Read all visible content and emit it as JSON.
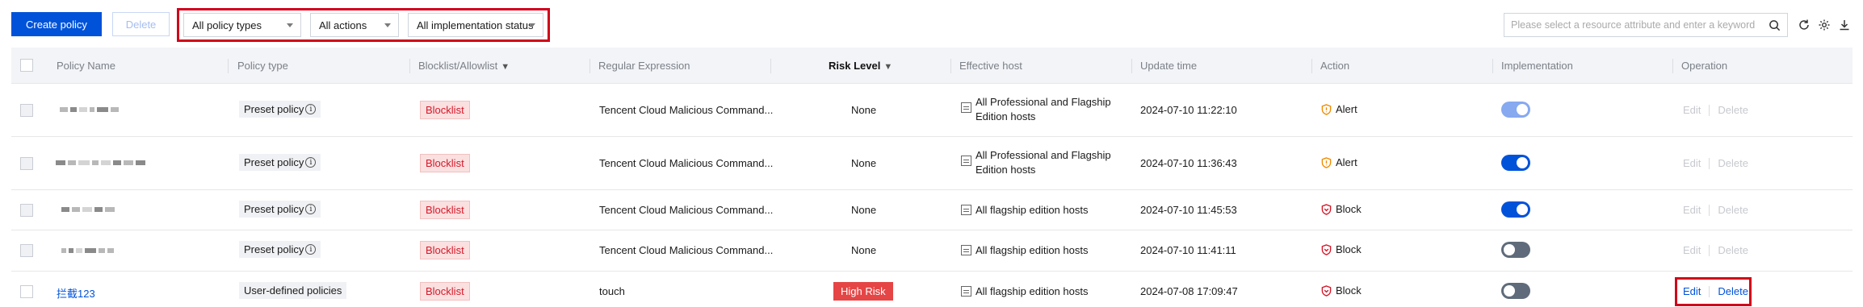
{
  "toolbar": {
    "create_label": "Create policy",
    "delete_label": "Delete",
    "filters": {
      "policy_types": "All policy types",
      "actions": "All actions",
      "implementation": "All implementation status"
    },
    "search_placeholder": "Please select a resource attribute and enter a keyword"
  },
  "columns": {
    "policy_name": "Policy Name",
    "policy_type": "Policy type",
    "list_type": "Blocklist/Allowlist",
    "regex": "Regular Expression",
    "risk_level": "Risk Level",
    "effective_host": "Effective host",
    "update_time": "Update time",
    "action": "Action",
    "implementation": "Implementation",
    "operation": "Operation"
  },
  "rows": [
    {
      "name": "",
      "type": "Preset policy",
      "list": "Blocklist",
      "regex": "Tencent Cloud Malicious Command...",
      "risk": "None",
      "host_line1": "All Professional and Flagship",
      "host_line2": "Edition hosts",
      "time": "2024-07-10 11:22:10",
      "action": "Alert",
      "implementation": "on-light",
      "edit": "Edit",
      "delete": "Delete"
    },
    {
      "name": "",
      "type": "Preset policy",
      "list": "Blocklist",
      "regex": "Tencent Cloud Malicious Command...",
      "risk": "None",
      "host_line1": "All Professional and Flagship",
      "host_line2": "Edition hosts",
      "time": "2024-07-10 11:36:43",
      "action": "Alert",
      "implementation": "on",
      "edit": "Edit",
      "delete": "Delete"
    },
    {
      "name": "",
      "type": "Preset policy",
      "list": "Blocklist",
      "regex": "Tencent Cloud Malicious Command...",
      "risk": "None",
      "host_line1": "All flagship edition hosts",
      "host_line2": "",
      "time": "2024-07-10 11:45:53",
      "action": "Block",
      "implementation": "on",
      "edit": "Edit",
      "delete": "Delete"
    },
    {
      "name": "",
      "type": "Preset policy",
      "list": "Blocklist",
      "regex": "Tencent Cloud Malicious Command...",
      "risk": "None",
      "host_line1": "All flagship edition hosts",
      "host_line2": "",
      "time": "2024-07-10 11:41:11",
      "action": "Block",
      "implementation": "off",
      "edit": "Edit",
      "delete": "Delete"
    },
    {
      "name": "拦截123",
      "type": "User-defined policies",
      "list": "Blocklist",
      "regex": "touch",
      "risk": "High Risk",
      "host_line1": "All flagship edition hosts",
      "host_line2": "",
      "time": "2024-07-08 17:09:47",
      "action": "Block",
      "implementation": "off",
      "edit": "Edit",
      "delete": "Delete"
    }
  ],
  "colors": {
    "primary": "#0052d9",
    "highlight_border": "#d0021b",
    "high_risk": "#e54545",
    "blocklist_text": "#d4192a",
    "alert_icon": "#f08c00",
    "block_icon": "#d4192a"
  }
}
